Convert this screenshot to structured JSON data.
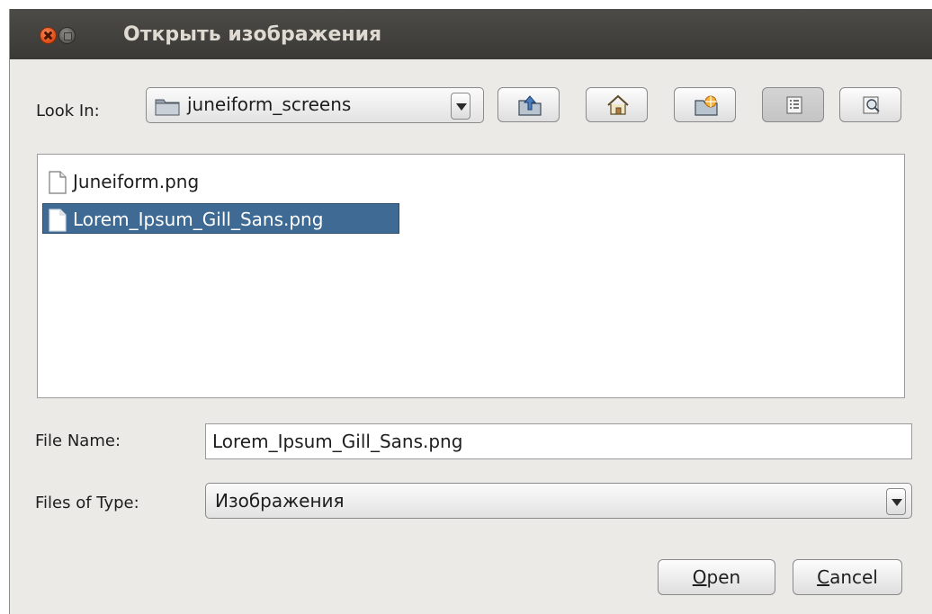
{
  "window": {
    "title": "Открыть изображения"
  },
  "look_in": {
    "label": "Look In:",
    "value": "juneiform_screens"
  },
  "toolbar": {
    "buttons": [
      {
        "icon": "up-folder-icon"
      },
      {
        "icon": "home-icon"
      },
      {
        "icon": "new-folder-icon"
      },
      {
        "icon": "list-view-icon",
        "selected": true
      },
      {
        "icon": "details-view-icon"
      }
    ]
  },
  "files": [
    {
      "name": "Juneiform.png",
      "selected": false
    },
    {
      "name": "Lorem_Ipsum_Gill_Sans.png",
      "selected": true
    }
  ],
  "file_name": {
    "label": "File Name:",
    "value": "Lorem_Ipsum_Gill_Sans.png"
  },
  "file_type": {
    "label": "Files of Type:",
    "value": "Изображения"
  },
  "actions": {
    "open": {
      "mnemonic": "O",
      "rest": "pen"
    },
    "cancel": {
      "mnemonic": "C",
      "rest": "ancel"
    }
  },
  "colors": {
    "titlebar": "#3f3e3a",
    "selection": "#3e6a93",
    "dialog_bg": "#eceae6"
  }
}
